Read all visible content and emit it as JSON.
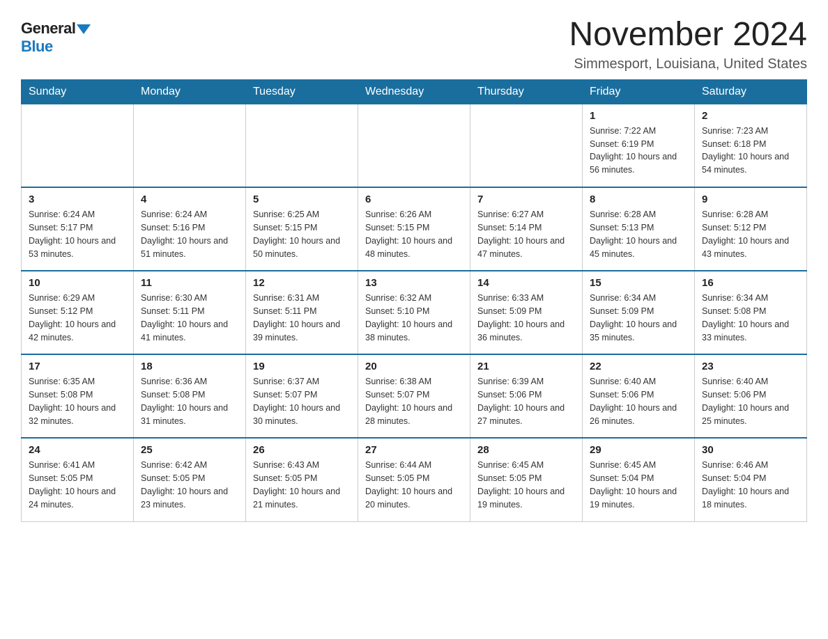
{
  "logo": {
    "general": "General",
    "blue": "Blue"
  },
  "title": {
    "month": "November 2024",
    "location": "Simmesport, Louisiana, United States"
  },
  "days_of_week": [
    "Sunday",
    "Monday",
    "Tuesday",
    "Wednesday",
    "Thursday",
    "Friday",
    "Saturday"
  ],
  "weeks": [
    [
      {
        "day": "",
        "info": ""
      },
      {
        "day": "",
        "info": ""
      },
      {
        "day": "",
        "info": ""
      },
      {
        "day": "",
        "info": ""
      },
      {
        "day": "",
        "info": ""
      },
      {
        "day": "1",
        "info": "Sunrise: 7:22 AM\nSunset: 6:19 PM\nDaylight: 10 hours and 56 minutes."
      },
      {
        "day": "2",
        "info": "Sunrise: 7:23 AM\nSunset: 6:18 PM\nDaylight: 10 hours and 54 minutes."
      }
    ],
    [
      {
        "day": "3",
        "info": "Sunrise: 6:24 AM\nSunset: 5:17 PM\nDaylight: 10 hours and 53 minutes."
      },
      {
        "day": "4",
        "info": "Sunrise: 6:24 AM\nSunset: 5:16 PM\nDaylight: 10 hours and 51 minutes."
      },
      {
        "day": "5",
        "info": "Sunrise: 6:25 AM\nSunset: 5:15 PM\nDaylight: 10 hours and 50 minutes."
      },
      {
        "day": "6",
        "info": "Sunrise: 6:26 AM\nSunset: 5:15 PM\nDaylight: 10 hours and 48 minutes."
      },
      {
        "day": "7",
        "info": "Sunrise: 6:27 AM\nSunset: 5:14 PM\nDaylight: 10 hours and 47 minutes."
      },
      {
        "day": "8",
        "info": "Sunrise: 6:28 AM\nSunset: 5:13 PM\nDaylight: 10 hours and 45 minutes."
      },
      {
        "day": "9",
        "info": "Sunrise: 6:28 AM\nSunset: 5:12 PM\nDaylight: 10 hours and 43 minutes."
      }
    ],
    [
      {
        "day": "10",
        "info": "Sunrise: 6:29 AM\nSunset: 5:12 PM\nDaylight: 10 hours and 42 minutes."
      },
      {
        "day": "11",
        "info": "Sunrise: 6:30 AM\nSunset: 5:11 PM\nDaylight: 10 hours and 41 minutes."
      },
      {
        "day": "12",
        "info": "Sunrise: 6:31 AM\nSunset: 5:11 PM\nDaylight: 10 hours and 39 minutes."
      },
      {
        "day": "13",
        "info": "Sunrise: 6:32 AM\nSunset: 5:10 PM\nDaylight: 10 hours and 38 minutes."
      },
      {
        "day": "14",
        "info": "Sunrise: 6:33 AM\nSunset: 5:09 PM\nDaylight: 10 hours and 36 minutes."
      },
      {
        "day": "15",
        "info": "Sunrise: 6:34 AM\nSunset: 5:09 PM\nDaylight: 10 hours and 35 minutes."
      },
      {
        "day": "16",
        "info": "Sunrise: 6:34 AM\nSunset: 5:08 PM\nDaylight: 10 hours and 33 minutes."
      }
    ],
    [
      {
        "day": "17",
        "info": "Sunrise: 6:35 AM\nSunset: 5:08 PM\nDaylight: 10 hours and 32 minutes."
      },
      {
        "day": "18",
        "info": "Sunrise: 6:36 AM\nSunset: 5:08 PM\nDaylight: 10 hours and 31 minutes."
      },
      {
        "day": "19",
        "info": "Sunrise: 6:37 AM\nSunset: 5:07 PM\nDaylight: 10 hours and 30 minutes."
      },
      {
        "day": "20",
        "info": "Sunrise: 6:38 AM\nSunset: 5:07 PM\nDaylight: 10 hours and 28 minutes."
      },
      {
        "day": "21",
        "info": "Sunrise: 6:39 AM\nSunset: 5:06 PM\nDaylight: 10 hours and 27 minutes."
      },
      {
        "day": "22",
        "info": "Sunrise: 6:40 AM\nSunset: 5:06 PM\nDaylight: 10 hours and 26 minutes."
      },
      {
        "day": "23",
        "info": "Sunrise: 6:40 AM\nSunset: 5:06 PM\nDaylight: 10 hours and 25 minutes."
      }
    ],
    [
      {
        "day": "24",
        "info": "Sunrise: 6:41 AM\nSunset: 5:05 PM\nDaylight: 10 hours and 24 minutes."
      },
      {
        "day": "25",
        "info": "Sunrise: 6:42 AM\nSunset: 5:05 PM\nDaylight: 10 hours and 23 minutes."
      },
      {
        "day": "26",
        "info": "Sunrise: 6:43 AM\nSunset: 5:05 PM\nDaylight: 10 hours and 21 minutes."
      },
      {
        "day": "27",
        "info": "Sunrise: 6:44 AM\nSunset: 5:05 PM\nDaylight: 10 hours and 20 minutes."
      },
      {
        "day": "28",
        "info": "Sunrise: 6:45 AM\nSunset: 5:05 PM\nDaylight: 10 hours and 19 minutes."
      },
      {
        "day": "29",
        "info": "Sunrise: 6:45 AM\nSunset: 5:04 PM\nDaylight: 10 hours and 19 minutes."
      },
      {
        "day": "30",
        "info": "Sunrise: 6:46 AM\nSunset: 5:04 PM\nDaylight: 10 hours and 18 minutes."
      }
    ]
  ]
}
